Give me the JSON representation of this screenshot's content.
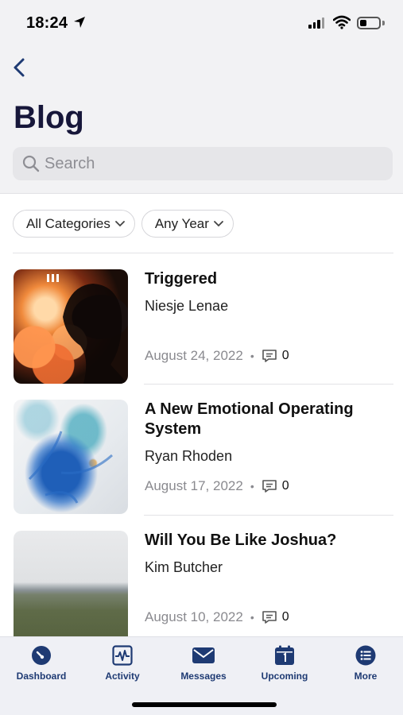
{
  "status_bar": {
    "time": "18:24"
  },
  "header": {
    "title": "Blog"
  },
  "search": {
    "placeholder": "Search"
  },
  "filters": {
    "category": "All Categories",
    "year": "Any Year"
  },
  "posts": [
    {
      "title": "Triggered",
      "author": "Niesje Lenae",
      "date": "August 24, 2022",
      "comments": "0"
    },
    {
      "title": "A New Emotional Operating System",
      "author": "Ryan Rhoden",
      "date": "August 17, 2022",
      "comments": "0"
    },
    {
      "title": "Will You Be Like Joshua?",
      "author": "Kim Butcher",
      "date": "August 10, 2022",
      "comments": "0"
    }
  ],
  "tabs": [
    {
      "label": "Dashboard",
      "icon": "dashboard-icon"
    },
    {
      "label": "Activity",
      "icon": "activity-icon"
    },
    {
      "label": "Messages",
      "icon": "envelope-icon"
    },
    {
      "label": "Upcoming",
      "icon": "calendar-icon"
    },
    {
      "label": "More",
      "icon": "list-icon"
    }
  ],
  "colors": {
    "accent": "#1e3a73",
    "title": "#17173a",
    "muted": "#8a8a8f",
    "tabbar_bg": "#eff0f5"
  }
}
